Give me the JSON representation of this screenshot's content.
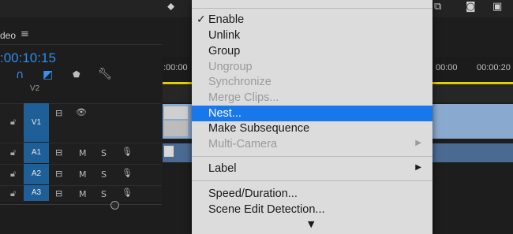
{
  "panel": {
    "title": "deo",
    "menu_icon": "≡",
    "timecode": ":00:10:15",
    "v2_label": "V2"
  },
  "ruler": {
    "t0": ":00:00",
    "t1": "00:00",
    "t2": "00:00:20"
  },
  "tracks": [
    {
      "label": "V1",
      "toggles": []
    },
    {
      "label": "A1",
      "toggles": [
        "M",
        "S"
      ]
    },
    {
      "label": "A2",
      "toggles": [
        "M",
        "S"
      ]
    },
    {
      "label": "A3",
      "toggles": [
        "M",
        "S"
      ]
    }
  ],
  "context_menu": {
    "items": [
      {
        "label": "Enable",
        "checked": true
      },
      {
        "label": "Unlink"
      },
      {
        "label": "Group"
      },
      {
        "label": "Ungroup",
        "disabled": true
      },
      {
        "label": "Synchronize",
        "disabled": true
      },
      {
        "label": "Merge Clips...",
        "disabled": true
      },
      {
        "label": "Nest...",
        "highlighted": true
      },
      {
        "label": "Make Subsequence"
      },
      {
        "label": "Multi-Camera",
        "disabled": true,
        "submenu": true
      },
      {
        "label": "Label",
        "submenu": true
      },
      {
        "label": "Speed/Duration..."
      },
      {
        "label": "Scene Edit Detection..."
      }
    ],
    "check_glyph": "✓",
    "submenu_glyph": "▶",
    "scroll_glyph": "▼"
  },
  "colors": {
    "accent_blue": "#2d8ceb",
    "menu_highlight": "#1877ea",
    "track_badge": "#1f5f98",
    "playhead_bar": "#dcd000"
  }
}
